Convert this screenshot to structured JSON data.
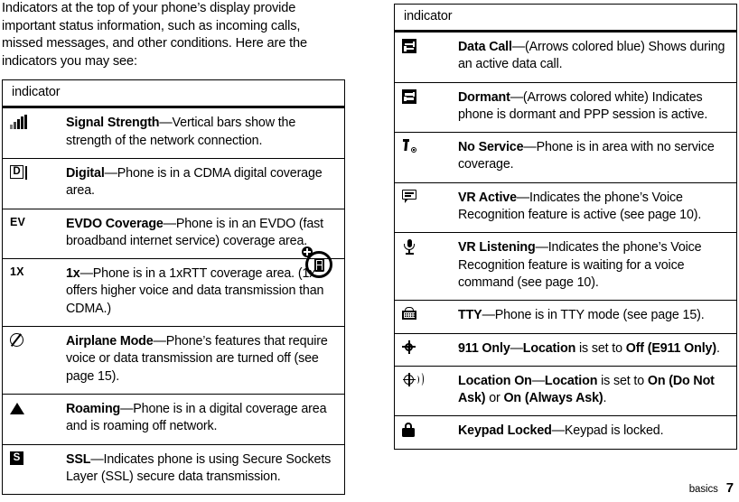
{
  "intro_paragraph": "Indicators at the top of your phone’s display provide important status information, such as incoming calls, missed messages, and other conditions. Here are the indicators you may see:",
  "left_table": {
    "header": "indicator",
    "rows": [
      {
        "icon": "signal-strength-icon",
        "icon_kind": "signal",
        "term": "Signal Strength",
        "description": "—Vertical bars show the strength of the network connection."
      },
      {
        "icon": "digital-d-icon",
        "icon_kind": "boxletter",
        "icon_text": "D",
        "term": "Digital",
        "description": "—Phone is in a CDMA digital coverage area."
      },
      {
        "icon": "evdo-ev-icon",
        "icon_kind": "text",
        "icon_text": "EV",
        "term": "EVDO Coverage",
        "description": "—Phone is in an EVDO (fast broadband internet service) coverage area.",
        "badge": "evdo-phone-plus-badge"
      },
      {
        "icon": "onex-icon",
        "icon_kind": "text",
        "icon_text": "1X",
        "term": "1x",
        "description": "—Phone is in a 1xRTT coverage area. (1x offers higher voice and data transmission than CDMA.)"
      },
      {
        "icon": "airplane-mode-icon",
        "icon_kind": "airplane",
        "term": "Airplane Mode",
        "description": "—Phone’s features that require voice or data transmission are turned off (see page 15)."
      },
      {
        "icon": "roaming-triangle-icon",
        "icon_kind": "triangle",
        "term": "Roaming",
        "description": "—Phone is in a digital coverage area and is roaming off network."
      },
      {
        "icon": "ssl-s-icon",
        "icon_kind": "boxletter-solid",
        "icon_text": "S",
        "term": "SSL",
        "description": "—Indicates phone is using Secure Sockets Layer (SSL) secure data transmission."
      }
    ]
  },
  "right_table": {
    "header": "indicator",
    "rows": [
      {
        "icon": "data-call-arrows-icon",
        "icon_kind": "datacall",
        "term": "Data Call",
        "description": "—(Arrows colored blue) Shows during an active data call."
      },
      {
        "icon": "dormant-arrows-icon",
        "icon_kind": "datacall",
        "term": "Dormant",
        "description": "—(Arrows colored white) Indicates phone is dormant and PPP session is active."
      },
      {
        "icon": "no-service-icon",
        "icon_kind": "noservice",
        "term": "No Service",
        "description": "—Phone is in area with no service coverage."
      },
      {
        "icon": "vr-active-bubble-icon",
        "icon_kind": "bubble",
        "term": "VR Active",
        "description": "—Indicates the phone’s Voice Recognition feature is active (see page 10)."
      },
      {
        "icon": "vr-listening-mic-icon",
        "icon_kind": "mic",
        "term": "VR Listening",
        "description": "—Indicates the phone’s Voice Recognition feature is waiting for a voice command (see page 10)."
      },
      {
        "icon": "tty-icon",
        "icon_kind": "tty",
        "term": "TTY",
        "description": "—Phone is in TTY mode (see page 15)."
      },
      {
        "icon": "911-only-target-icon",
        "icon_kind": "target",
        "term": "911 Only",
        "description_rich": true,
        "parts": [
          {
            "text": "—",
            "bold": false
          },
          {
            "text": "Location",
            "bold": true
          },
          {
            "text": " is set to ",
            "bold": false
          },
          {
            "text": "Off (E911 Only)",
            "bold": true
          },
          {
            "text": ".",
            "bold": false
          }
        ]
      },
      {
        "icon": "location-on-icon",
        "icon_kind": "locon",
        "term": "Location On",
        "description_rich": true,
        "parts": [
          {
            "text": "—",
            "bold": false
          },
          {
            "text": "Location",
            "bold": true
          },
          {
            "text": " is set to ",
            "bold": false
          },
          {
            "text": "On (Do Not Ask)",
            "bold": true
          },
          {
            "text": " or ",
            "bold": false
          },
          {
            "text": "On (Always Ask)",
            "bold": true
          },
          {
            "text": ".",
            "bold": false
          }
        ]
      },
      {
        "icon": "keypad-locked-padlock-icon",
        "icon_kind": "lock",
        "term": "Keypad Locked",
        "description": "—Keypad is locked."
      }
    ]
  },
  "footer": {
    "section": "basics",
    "page_number": "7"
  }
}
